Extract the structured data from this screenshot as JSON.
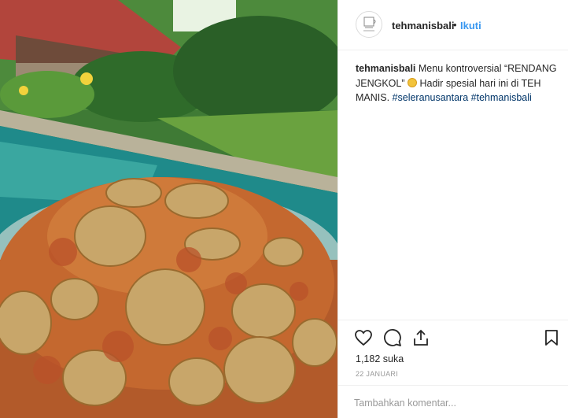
{
  "post": {
    "photo_alt": "Rendang Jengkol in glass bowl beside pool",
    "username": "tehmanisbali",
    "separator": "•",
    "follow_label": "Ikuti",
    "avatar_icon": "teh-manis-logo-icon",
    "caption": {
      "user": "tehmanisbali",
      "text_1": " Menu kontroversial “RENDANG JENGKOL” ",
      "emoji": "smiling-face-emoji",
      "text_2": " Hadir spesial hari ini di TEH MANIS. ",
      "hashtag_1": "#seleranusantara",
      "hashtag_2": "#tehmanisbali"
    },
    "actions": {
      "like_icon": "heart-icon",
      "comment_icon": "comment-bubble-icon",
      "share_icon": "share-icon",
      "save_icon": "bookmark-icon"
    },
    "likes": "1,182 suka",
    "date": "22 JANUARI",
    "comment_placeholder": "Tambahkan komentar..."
  },
  "colors": {
    "link_blue": "#3897f0",
    "hashtag": "#003569",
    "muted": "#999999",
    "text": "#262626"
  }
}
